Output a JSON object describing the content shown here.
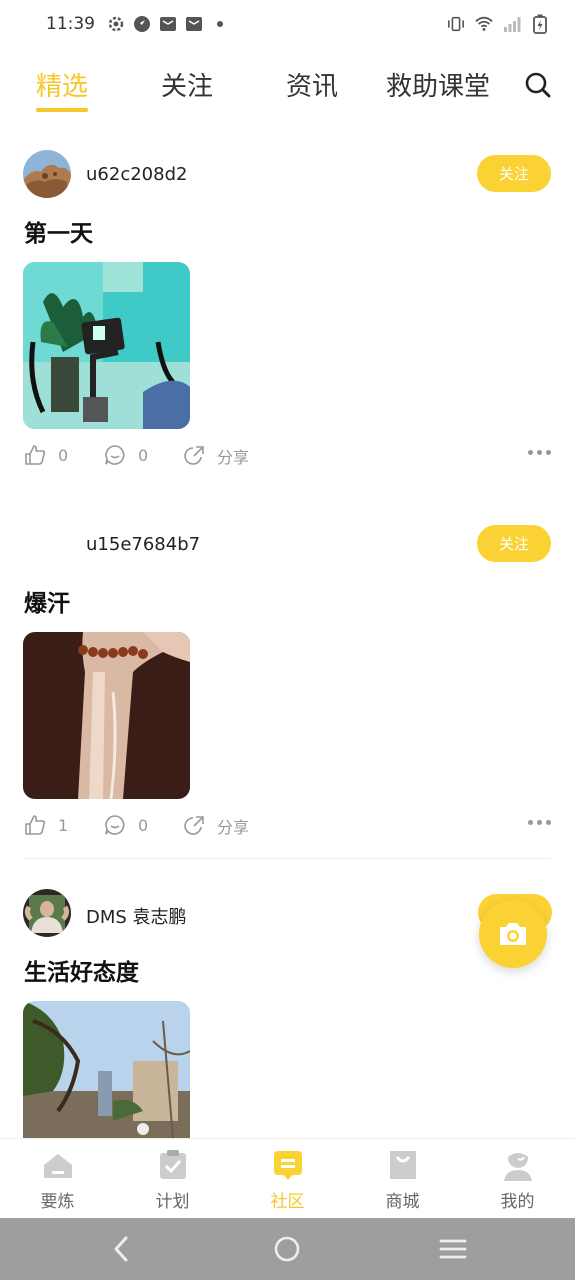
{
  "status_bar": {
    "time": "11:39",
    "left_icons": [
      "settings-gear-icon",
      "compass-icon",
      "mail-icon",
      "mail-icon",
      "dot-icon"
    ],
    "right_icons": [
      "vibrate-icon",
      "wifi-icon",
      "signal-icon",
      "battery-charging-icon"
    ]
  },
  "top_tabs": [
    {
      "label": "精选",
      "active": true
    },
    {
      "label": "关注",
      "active": false
    },
    {
      "label": "资讯",
      "active": false
    },
    {
      "label": "救助课堂",
      "active": false
    }
  ],
  "colors": {
    "accent": "#fad234",
    "accent_text": "#f7c72a",
    "muted": "#999999"
  },
  "posts": [
    {
      "username": "u62c208d2",
      "follow_label": "关注",
      "title": "第一天",
      "likes": "0",
      "comments": "0",
      "share_label": "分享"
    },
    {
      "username": "u15e7684b7",
      "follow_label": "关注",
      "title": "爆汗",
      "likes": "1",
      "comments": "0",
      "share_label": "分享"
    },
    {
      "username": "DMS 袁志鹏",
      "follow_label": "关注",
      "title": "生活好态度"
    }
  ],
  "bottom_nav": [
    {
      "label": "要炼",
      "icon": "home-icon",
      "active": false
    },
    {
      "label": "计划",
      "icon": "clipboard-check-icon",
      "active": false
    },
    {
      "label": "社区",
      "icon": "chat-bubble-icon",
      "active": true
    },
    {
      "label": "商城",
      "icon": "shopping-bag-icon",
      "active": false
    },
    {
      "label": "我的",
      "icon": "user-icon",
      "active": false
    }
  ]
}
